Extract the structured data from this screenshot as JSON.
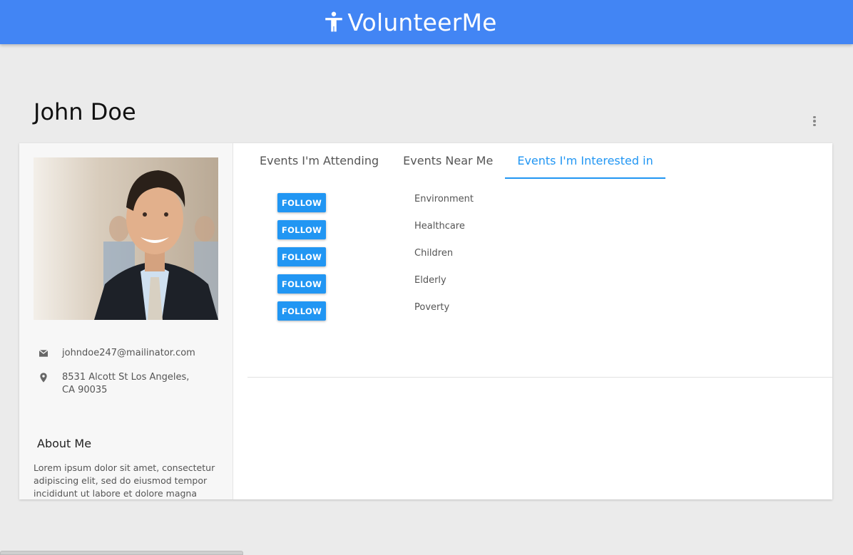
{
  "app": {
    "title": "VolunteerMe",
    "brand_icon": "accessibility-icon",
    "header_color": "#4285f4",
    "accent_color": "#2196f3"
  },
  "profile": {
    "name": "John Doe",
    "email": "johndoe247@mailinator.com",
    "address": "8531 Alcott St Los Angeles, CA 90035",
    "about_title": "About Me",
    "about_text": "Lorem ipsum dolor sit amet, consectetur adipiscing elit, sed do eiusmod tempor incididunt ut labore et dolore magna"
  },
  "tabs": [
    {
      "label": "Events I'm Attending",
      "active": false
    },
    {
      "label": "Events Near Me",
      "active": false
    },
    {
      "label": "Events I'm Interested in",
      "active": true
    }
  ],
  "interests": [
    {
      "button": "FOLLOW",
      "label": "Environment"
    },
    {
      "button": "FOLLOW",
      "label": "Healthcare"
    },
    {
      "button": "FOLLOW",
      "label": "Children"
    },
    {
      "button": "FOLLOW",
      "label": "Elderly"
    },
    {
      "button": "FOLLOW",
      "label": "Poverty"
    }
  ]
}
